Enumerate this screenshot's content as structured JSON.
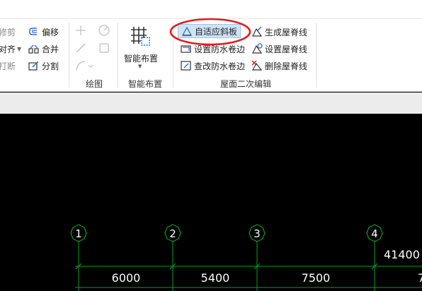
{
  "ribbon": {
    "col1": {
      "b1": "修剪",
      "b2": "对齐",
      "b3": "打断"
    },
    "col2": {
      "offset": "偏移",
      "merge": "合并",
      "split": "分割"
    },
    "draw_group_label": "绘图",
    "smart": {
      "label": "智能布置",
      "group_label": "智能布置"
    },
    "roof": {
      "adaptive_slab": "自适应斜板",
      "set_waterproof_edge": "设置防水卷边",
      "check_waterproof_edge": "查改防水卷边",
      "gen_ridge": "生成屋脊线",
      "set_ridge": "设置屋脊线",
      "del_ridge": "删除屋脊线",
      "group_label": "屋面二次编辑"
    }
  },
  "axes": {
    "labels": [
      "1",
      "2",
      "3",
      "4"
    ],
    "dimensions": [
      "6000",
      "5400",
      "7500"
    ],
    "total": "41400",
    "partial_next": "7"
  },
  "colors": {
    "highlight": "#e0191c",
    "grid": "#0f9a23",
    "active_bg": "#cfe3f7"
  }
}
